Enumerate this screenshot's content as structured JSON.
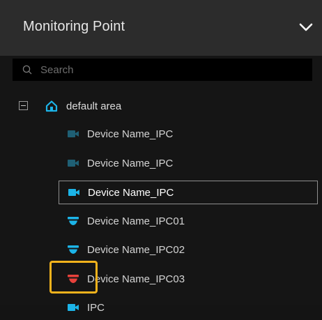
{
  "header": {
    "title": "Monitoring Point"
  },
  "search": {
    "placeholder": "Search"
  },
  "tree": {
    "root": {
      "label": "default area"
    },
    "items": [
      {
        "label": "Device Name_IPC",
        "icon": "camera-offline-icon",
        "color": "#1f5f74",
        "selected": false
      },
      {
        "label": "Device Name_IPC",
        "icon": "camera-offline-icon",
        "color": "#1f5f74",
        "selected": false
      },
      {
        "label": "Device Name_IPC",
        "icon": "camera-online-icon",
        "color": "#1cb4e8",
        "selected": true
      },
      {
        "label": "Device Name_IPC01",
        "icon": "dome-camera-online-icon",
        "color": "#1cb4e8",
        "selected": false
      },
      {
        "label": "Device Name_IPC02",
        "icon": "dome-camera-online-icon",
        "color": "#1cb4e8",
        "selected": false
      },
      {
        "label": "Device Name_IPC03",
        "icon": "dome-camera-alarm-icon",
        "color": "#e8413b",
        "selected": false
      },
      {
        "label": "IPC",
        "icon": "camera-online-icon",
        "color": "#1cb4e8",
        "selected": false
      }
    ]
  },
  "colors": {
    "accent": "#1cb4e8",
    "alarm": "#e8413b",
    "highlight": "#f2b21c"
  }
}
